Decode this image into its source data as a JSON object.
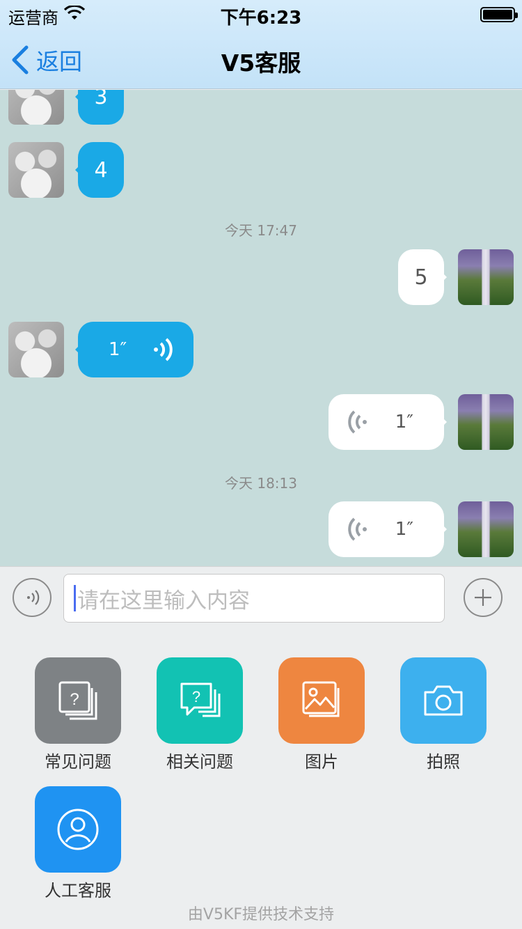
{
  "status_bar": {
    "carrier": "运营商",
    "time": "下午6:23"
  },
  "nav": {
    "back_label": "返回",
    "title": "V5客服"
  },
  "messages": [
    {
      "dir": "in",
      "type": "text",
      "text": "3"
    },
    {
      "dir": "in",
      "type": "text",
      "text": "4"
    },
    {
      "type": "time",
      "text": "今天 17:47"
    },
    {
      "dir": "out",
      "type": "text",
      "text": "5"
    },
    {
      "dir": "in",
      "type": "voice",
      "duration": "1″"
    },
    {
      "dir": "out",
      "type": "voice",
      "duration": "1″"
    },
    {
      "type": "time",
      "text": "今天 18:13"
    },
    {
      "dir": "out",
      "type": "voice",
      "duration": "1″"
    }
  ],
  "input": {
    "placeholder": "请在这里输入内容"
  },
  "tools": [
    {
      "label": "常见问题",
      "icon": "faq-icon",
      "color": "#7e8285"
    },
    {
      "label": "相关问题",
      "icon": "related-question-icon",
      "color": "#12c2b3"
    },
    {
      "label": "图片",
      "icon": "image-icon",
      "color": "#ee8640"
    },
    {
      "label": "拍照",
      "icon": "camera-icon",
      "color": "#3db0ee"
    },
    {
      "label": "人工客服",
      "icon": "agent-icon",
      "color": "#1f93f2"
    }
  ],
  "footer": "由V5KF提供技术支持",
  "colors": {
    "incoming_bubble": "#1aa9e6",
    "outgoing_bubble": "#ffffff",
    "accent": "#1a7fe0",
    "chat_bg": "#c6dcdb"
  }
}
